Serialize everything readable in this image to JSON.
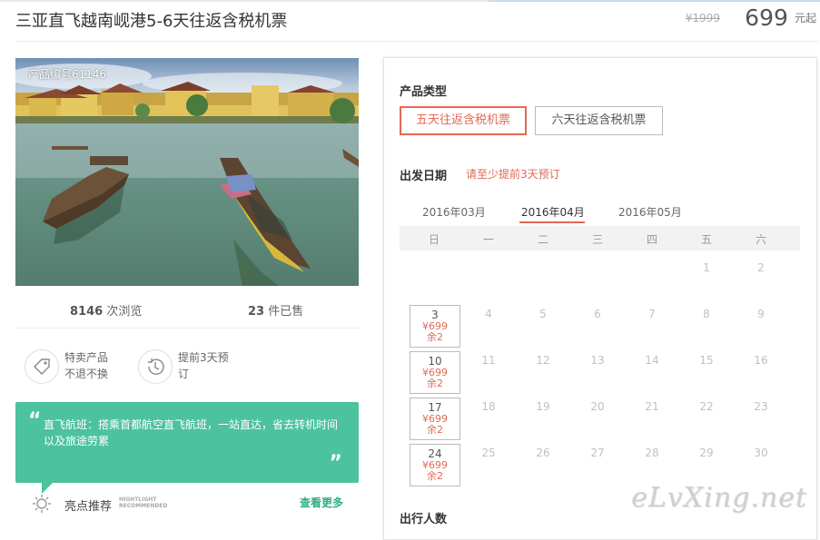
{
  "product": {
    "title": "三亚直飞越南岘港5-6天往返含税机票",
    "old_price": "¥1999",
    "price": "699",
    "price_unit": "元起",
    "product_id": "产品编号61146"
  },
  "stats": {
    "views_count": "8146",
    "views_label": "次浏览",
    "sold_count": "23",
    "sold_label": "件已售"
  },
  "features": [
    {
      "line1": "特卖产品",
      "line2": "不退不换",
      "icon": "tag-icon"
    },
    {
      "line1": "提前3天预",
      "line2": "订",
      "icon": "clock-icon"
    }
  ],
  "highlight": {
    "quote": "直飞航班：搭乘首都航空直飞航班，一站直达，省去转机时间以及旅途劳累",
    "title": "亮点推荐",
    "title_en_1": "HIGHTLIGHT",
    "title_en_2": "RECOMMENDED",
    "more": "查看更多"
  },
  "booking": {
    "type_label": "产品类型",
    "types": [
      "五天往返含税机票",
      "六天往返含税机票"
    ],
    "selected_type": 0,
    "date_label": "出发日期",
    "date_hint": "请至少提前3天预订",
    "months": [
      "2016年03月",
      "2016年04月",
      "2016年05月"
    ],
    "active_month": 1,
    "weekdays": [
      "日",
      "一",
      "二",
      "三",
      "四",
      "五",
      "六"
    ],
    "days": [
      "1",
      "2",
      "3",
      "4",
      "5",
      "6",
      "7",
      "8",
      "9",
      "10",
      "11",
      "12",
      "13",
      "14",
      "15",
      "16",
      "17",
      "18",
      "19",
      "20",
      "21",
      "22",
      "23",
      "24",
      "25",
      "26",
      "27",
      "28",
      "29",
      "30"
    ],
    "available": [
      {
        "day": "3",
        "price": "¥699",
        "stock": "余2"
      },
      {
        "day": "10",
        "price": "¥699",
        "stock": "余2"
      },
      {
        "day": "17",
        "price": "¥699",
        "stock": "余2"
      },
      {
        "day": "24",
        "price": "¥699",
        "stock": "余2"
      }
    ],
    "travelers_label": "出行人数"
  },
  "watermark": "eLvXing.net",
  "colors": {
    "accent": "#e06a53",
    "green": "#4cc29e",
    "link_green": "#2fae80"
  }
}
